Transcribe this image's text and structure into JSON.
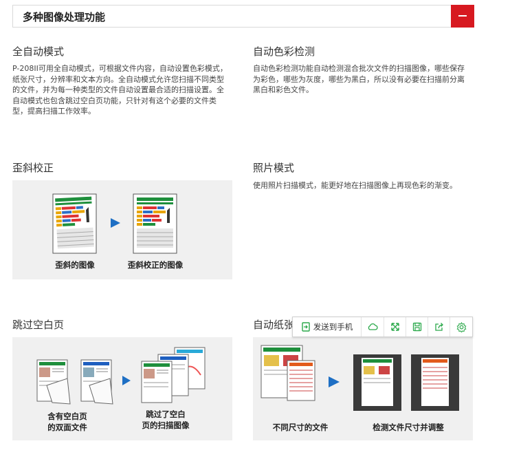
{
  "section": {
    "title": "多种图像处理功能"
  },
  "features": {
    "auto_mode": {
      "title": "全自动模式",
      "desc": "P-208II可用全自动模式，可根据文件内容，自动设置色彩模式，纸张尺寸，分辨率和文本方向。全自动模式允许您扫描不同类型的文件，并为每一种类型的文件自动设置最合适的扫描设置。全自动模式也包含跳过空白页功能，只针对有这个必要的文件类型，提高扫描工作效率。"
    },
    "color_detect": {
      "title": "自动色彩检测",
      "desc": "自动色彩检测功能自动检测混合批次文件的扫描图像，哪些保存为彩色，哪些为灰度，哪些为黑白，所以没有必要在扫描前分离黑白和彩色文件。"
    },
    "deskew": {
      "title": "歪斜校正",
      "caption_before": "歪斜的图像",
      "caption_after": "歪斜校正的图像"
    },
    "photo_mode": {
      "title": "照片模式",
      "desc": "使用照片扫描模式，能更好地在扫描图像上再现色彩的渐变。"
    },
    "skip_blank": {
      "title": "跳过空白页",
      "caption_before_1": "含有空白页",
      "caption_before_2": "的双面文件",
      "caption_after_1": "跳过了空白",
      "caption_after_2": "页的扫描图像"
    },
    "auto_size": {
      "title": "自动纸张",
      "caption_before": "不同尺寸的文件",
      "caption_after": "检测文件尺寸并调整"
    }
  },
  "toolbar": {
    "send_label": "发送到手机",
    "icons": [
      "send-to-phone-icon",
      "cloud-icon",
      "fullscreen-icon",
      "save-icon",
      "share-icon",
      "settings-icon"
    ],
    "accent": "#2aa84a"
  },
  "colors": {
    "accent_red": "#d71920",
    "panel_bg": "#f0f0f0",
    "report_green": "#1e8f3c",
    "arrow_blue": "#1e6fc4"
  }
}
